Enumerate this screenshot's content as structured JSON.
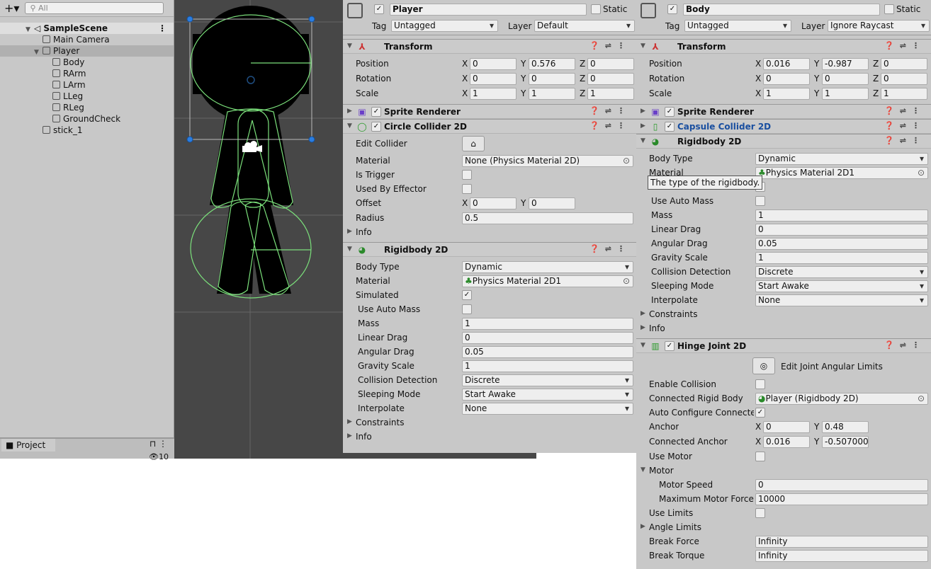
{
  "hierarchy": {
    "search_placeholder": "All",
    "scene": "SampleScene",
    "items": [
      {
        "label": "Main Camera",
        "depth": 1
      },
      {
        "label": "Player",
        "depth": 1,
        "expanded": true,
        "selected": true
      },
      {
        "label": "Body",
        "depth": 2
      },
      {
        "label": "RArm",
        "depth": 2
      },
      {
        "label": "LArm",
        "depth": 2
      },
      {
        "label": "LLeg",
        "depth": 2
      },
      {
        "label": "RLeg",
        "depth": 2
      },
      {
        "label": "GroundCheck",
        "depth": 2
      },
      {
        "label": "stick_1",
        "depth": 1
      }
    ]
  },
  "project": {
    "tab": "Project",
    "count": "10"
  },
  "tooltip": "The type of the rigidbody.",
  "inspectors": [
    {
      "name": "Player",
      "active": true,
      "static_label": "Static",
      "tag_label": "Tag",
      "tag": "Untagged",
      "layer_label": "Layer",
      "layer": "Default",
      "components": [
        {
          "title": "Transform",
          "icon": "transform-icon",
          "checkbox": false,
          "expanded": true,
          "rows": [
            {
              "k": "vec",
              "label": "Position",
              "v": [
                "0",
                "0.576",
                "0"
              ]
            },
            {
              "k": "vec",
              "label": "Rotation",
              "v": [
                "0",
                "0",
                "0"
              ]
            },
            {
              "k": "vec",
              "label": "Scale",
              "v": [
                "1",
                "1",
                "1"
              ]
            }
          ]
        },
        {
          "title": "Sprite Renderer",
          "icon": "sprite-renderer-icon",
          "checkbox": true,
          "expanded": false,
          "rows": []
        },
        {
          "title": "Circle Collider 2D",
          "icon": "circle-collider-icon",
          "checkbox": true,
          "expanded": true,
          "rows": [
            {
              "k": "btn",
              "label": "Edit Collider"
            },
            {
              "k": "obj",
              "label": "Material",
              "v": "None (Physics Material 2D)"
            },
            {
              "k": "chk",
              "label": "Is Trigger",
              "v": false
            },
            {
              "k": "chk",
              "label": "Used By Effector",
              "v": false
            },
            {
              "k": "vec2",
              "label": "Offset",
              "v": [
                "0",
                "0"
              ]
            },
            {
              "k": "text",
              "label": "Radius",
              "v": "0.5"
            },
            {
              "k": "fold",
              "label": "Info"
            }
          ]
        },
        {
          "title": "Rigidbody 2D",
          "icon": "rigidbody-icon",
          "checkbox": false,
          "expanded": true,
          "rows": [
            {
              "k": "dd",
              "label": "Body Type",
              "v": "Dynamic"
            },
            {
              "k": "obj",
              "label": "Material",
              "v": "Physics Material 2D1",
              "mat": true
            },
            {
              "k": "chk",
              "label": "Simulated",
              "v": true
            },
            {
              "k": "chk",
              "label": "Use Auto Mass",
              "v": false,
              "ind": true
            },
            {
              "k": "text",
              "label": "Mass",
              "v": "1",
              "ind": true
            },
            {
              "k": "text",
              "label": "Linear Drag",
              "v": "0",
              "ind": true
            },
            {
              "k": "text",
              "label": "Angular Drag",
              "v": "0.05",
              "ind": true
            },
            {
              "k": "text",
              "label": "Gravity Scale",
              "v": "1",
              "ind": true
            },
            {
              "k": "dd",
              "label": "Collision Detection",
              "v": "Discrete",
              "ind": true
            },
            {
              "k": "dd",
              "label": "Sleeping Mode",
              "v": "Start Awake",
              "ind": true
            },
            {
              "k": "dd",
              "label": "Interpolate",
              "v": "None",
              "ind": true
            },
            {
              "k": "fold",
              "label": "Constraints"
            },
            {
              "k": "fold",
              "label": "Info"
            }
          ]
        }
      ]
    },
    {
      "name": "Body",
      "active": true,
      "static_label": "Static",
      "tag_label": "Tag",
      "tag": "Untagged",
      "layer_label": "Layer",
      "layer": "Ignore Raycast",
      "components": [
        {
          "title": "Transform",
          "icon": "transform-icon",
          "checkbox": false,
          "expanded": true,
          "rows": [
            {
              "k": "vec",
              "label": "Position",
              "v": [
                "0.016",
                "-0.987",
                "0"
              ]
            },
            {
              "k": "vec",
              "label": "Rotation",
              "v": [
                "0",
                "0",
                "0"
              ]
            },
            {
              "k": "vec",
              "label": "Scale",
              "v": [
                "1",
                "1",
                "1"
              ]
            }
          ]
        },
        {
          "title": "Sprite Renderer",
          "icon": "sprite-renderer-icon",
          "checkbox": true,
          "expanded": false,
          "rows": []
        },
        {
          "title": "Capsule Collider 2D",
          "icon": "capsule-collider-icon",
          "checkbox": true,
          "expanded": false,
          "highlight": true,
          "rows": []
        },
        {
          "title": "Rigidbody 2D",
          "icon": "rigidbody-icon",
          "checkbox": false,
          "expanded": true,
          "rows": [
            {
              "k": "dd",
              "label": "Body Type",
              "v": "Dynamic"
            },
            {
              "k": "obj",
              "label": "Material",
              "v": "Physics Material 2D1",
              "mat": true
            },
            {
              "k": "chk",
              "label": "Simulated",
              "v": true
            },
            {
              "k": "chk",
              "label": "Use Auto Mass",
              "v": false,
              "ind": true
            },
            {
              "k": "text",
              "label": "Mass",
              "v": "1",
              "ind": true
            },
            {
              "k": "text",
              "label": "Linear Drag",
              "v": "0",
              "ind": true
            },
            {
              "k": "text",
              "label": "Angular Drag",
              "v": "0.05",
              "ind": true
            },
            {
              "k": "text",
              "label": "Gravity Scale",
              "v": "1",
              "ind": true
            },
            {
              "k": "dd",
              "label": "Collision Detection",
              "v": "Discrete",
              "ind": true
            },
            {
              "k": "dd",
              "label": "Sleeping Mode",
              "v": "Start Awake",
              "ind": true
            },
            {
              "k": "dd",
              "label": "Interpolate",
              "v": "None",
              "ind": true
            },
            {
              "k": "fold",
              "label": "Constraints"
            },
            {
              "k": "fold",
              "label": "Info"
            }
          ]
        },
        {
          "title": "Hinge Joint 2D",
          "icon": "hinge-joint-icon",
          "checkbox": true,
          "expanded": true,
          "rows": [
            {
              "k": "btn2",
              "label": "Edit Joint Angular Limits"
            },
            {
              "k": "chk",
              "label": "Enable Collision",
              "v": false
            },
            {
              "k": "obj",
              "label": "Connected Rigid Body",
              "v": "Player (Rigidbody 2D)",
              "rb": true
            },
            {
              "k": "chk",
              "label": "Auto Configure Connected Anchor",
              "v": true
            },
            {
              "k": "vec2",
              "label": "Anchor",
              "v": [
                "0",
                "0.48"
              ]
            },
            {
              "k": "vec2",
              "label": "Connected Anchor",
              "v": [
                "0.016",
                "-0.507000"
              ]
            },
            {
              "k": "chk",
              "label": "Use Motor",
              "v": false
            },
            {
              "k": "foldopen",
              "label": "Motor"
            },
            {
              "k": "text",
              "label": "Motor Speed",
              "v": "0",
              "ind2": true
            },
            {
              "k": "text",
              "label": "Maximum Motor Force",
              "v": "10000",
              "ind2": true
            },
            {
              "k": "chk",
              "label": "Use Limits",
              "v": false
            },
            {
              "k": "fold",
              "label": "Angle Limits"
            },
            {
              "k": "text",
              "label": "Break Force",
              "v": "Infinity"
            },
            {
              "k": "text",
              "label": "Break Torque",
              "v": "Infinity"
            }
          ]
        }
      ]
    }
  ],
  "colors": {
    "panel": "#c8c8c8",
    "scene_bg": "#474747",
    "collider": "#7be07b",
    "handle": "#2a7de1",
    "highlight_title": "#1a4fa0"
  }
}
